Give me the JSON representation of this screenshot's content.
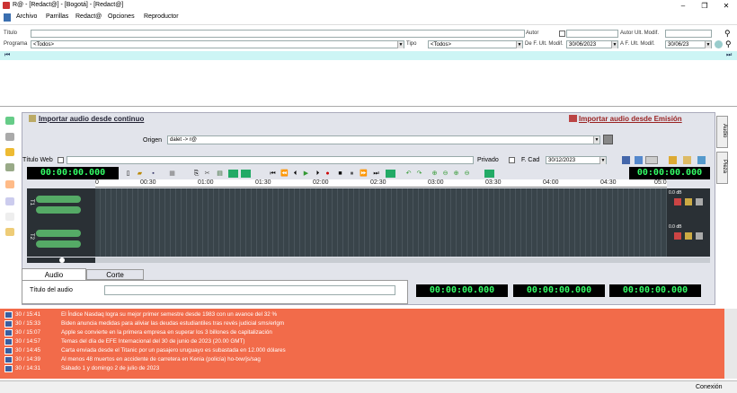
{
  "window": {
    "title": "R@ - [Redact@] - [Bogotá] - [Redact@]",
    "controls": [
      "–",
      "❐",
      "✕"
    ]
  },
  "menu": [
    "Archivo",
    "Parrillas",
    "Redact@",
    "Opciones",
    "Reproductor"
  ],
  "filters": {
    "titulo_label": "Título",
    "autor_label": "Autor",
    "autor_ult_label": "Autor Ult. Modif.",
    "programa_label": "Programa",
    "programa_value": "<Todos>",
    "tipo_label": "Tipo",
    "tipo_value": "<Todos>",
    "de_label": "De F. Ult. Modif.",
    "de_value": "30/06/2023",
    "a_label": "A F. Ult. Modif.",
    "a_value": "30/06/23"
  },
  "editor": {
    "import_continuo": "Importar audio desde continuo",
    "import_emision": "Importar audio desde Emisión",
    "origen_label": "Origen",
    "origen_value": "dalet -> r@",
    "titulo_web_label": "Título Web",
    "privado_label": "Privado",
    "fcad_label": "F. Cad",
    "fcad_value": "30/12/2023",
    "timer_left": "00:00:00.000",
    "timer_right": "00:00:00.000",
    "ruler": [
      "0",
      "00:30",
      "01:00",
      "01:30",
      "02:00",
      "02:30",
      "03:00",
      "03:30",
      "04:00",
      "04:30",
      "05:0"
    ],
    "track1": "T1",
    "track2": "T2",
    "db1": "0.0 dB",
    "db2": "0.0 dB",
    "tab_audio": "Audio",
    "tab_corte": "Corte",
    "titulo_audio_label": "Título del audio",
    "timers_bottom": [
      "00:00:00.000",
      "00:00:00.000",
      "00:00:00.000"
    ]
  },
  "side_tabs": [
    "Audio",
    "Pieza"
  ],
  "news": [
    {
      "time": "30 / 15:41",
      "text": "El Índice Nasdaq logra su mejor primer semestre desde 1983 con un avance del 32 %"
    },
    {
      "time": "30 / 15:33",
      "text": "Biden anuncia medidas para aliviar las deudas estudiantiles tras revés judicial sms/erlgm"
    },
    {
      "time": "30 / 15:07",
      "text": "Apple se convierte en la primera empresa en superar los 3 billones de capitalización"
    },
    {
      "time": "30 / 14:57",
      "text": "Temas del día de EFE Internacional del 30 de junio de 2023 (20.00 GMT)"
    },
    {
      "time": "30 / 14:45",
      "text": "Carta enviada desde el Titanic por un pasajero uruguayo es subastada en 12.000 dólares"
    },
    {
      "time": "30 / 14:39",
      "text": "Al menos 48 muertos en accidente de carretera en Kenia (policía) ho-txw/js/sag"
    },
    {
      "time": "30 / 14:31",
      "text": "Sábado 1 y domingo 2 de julio de 2023"
    }
  ],
  "status": {
    "connection": "Conexión"
  }
}
